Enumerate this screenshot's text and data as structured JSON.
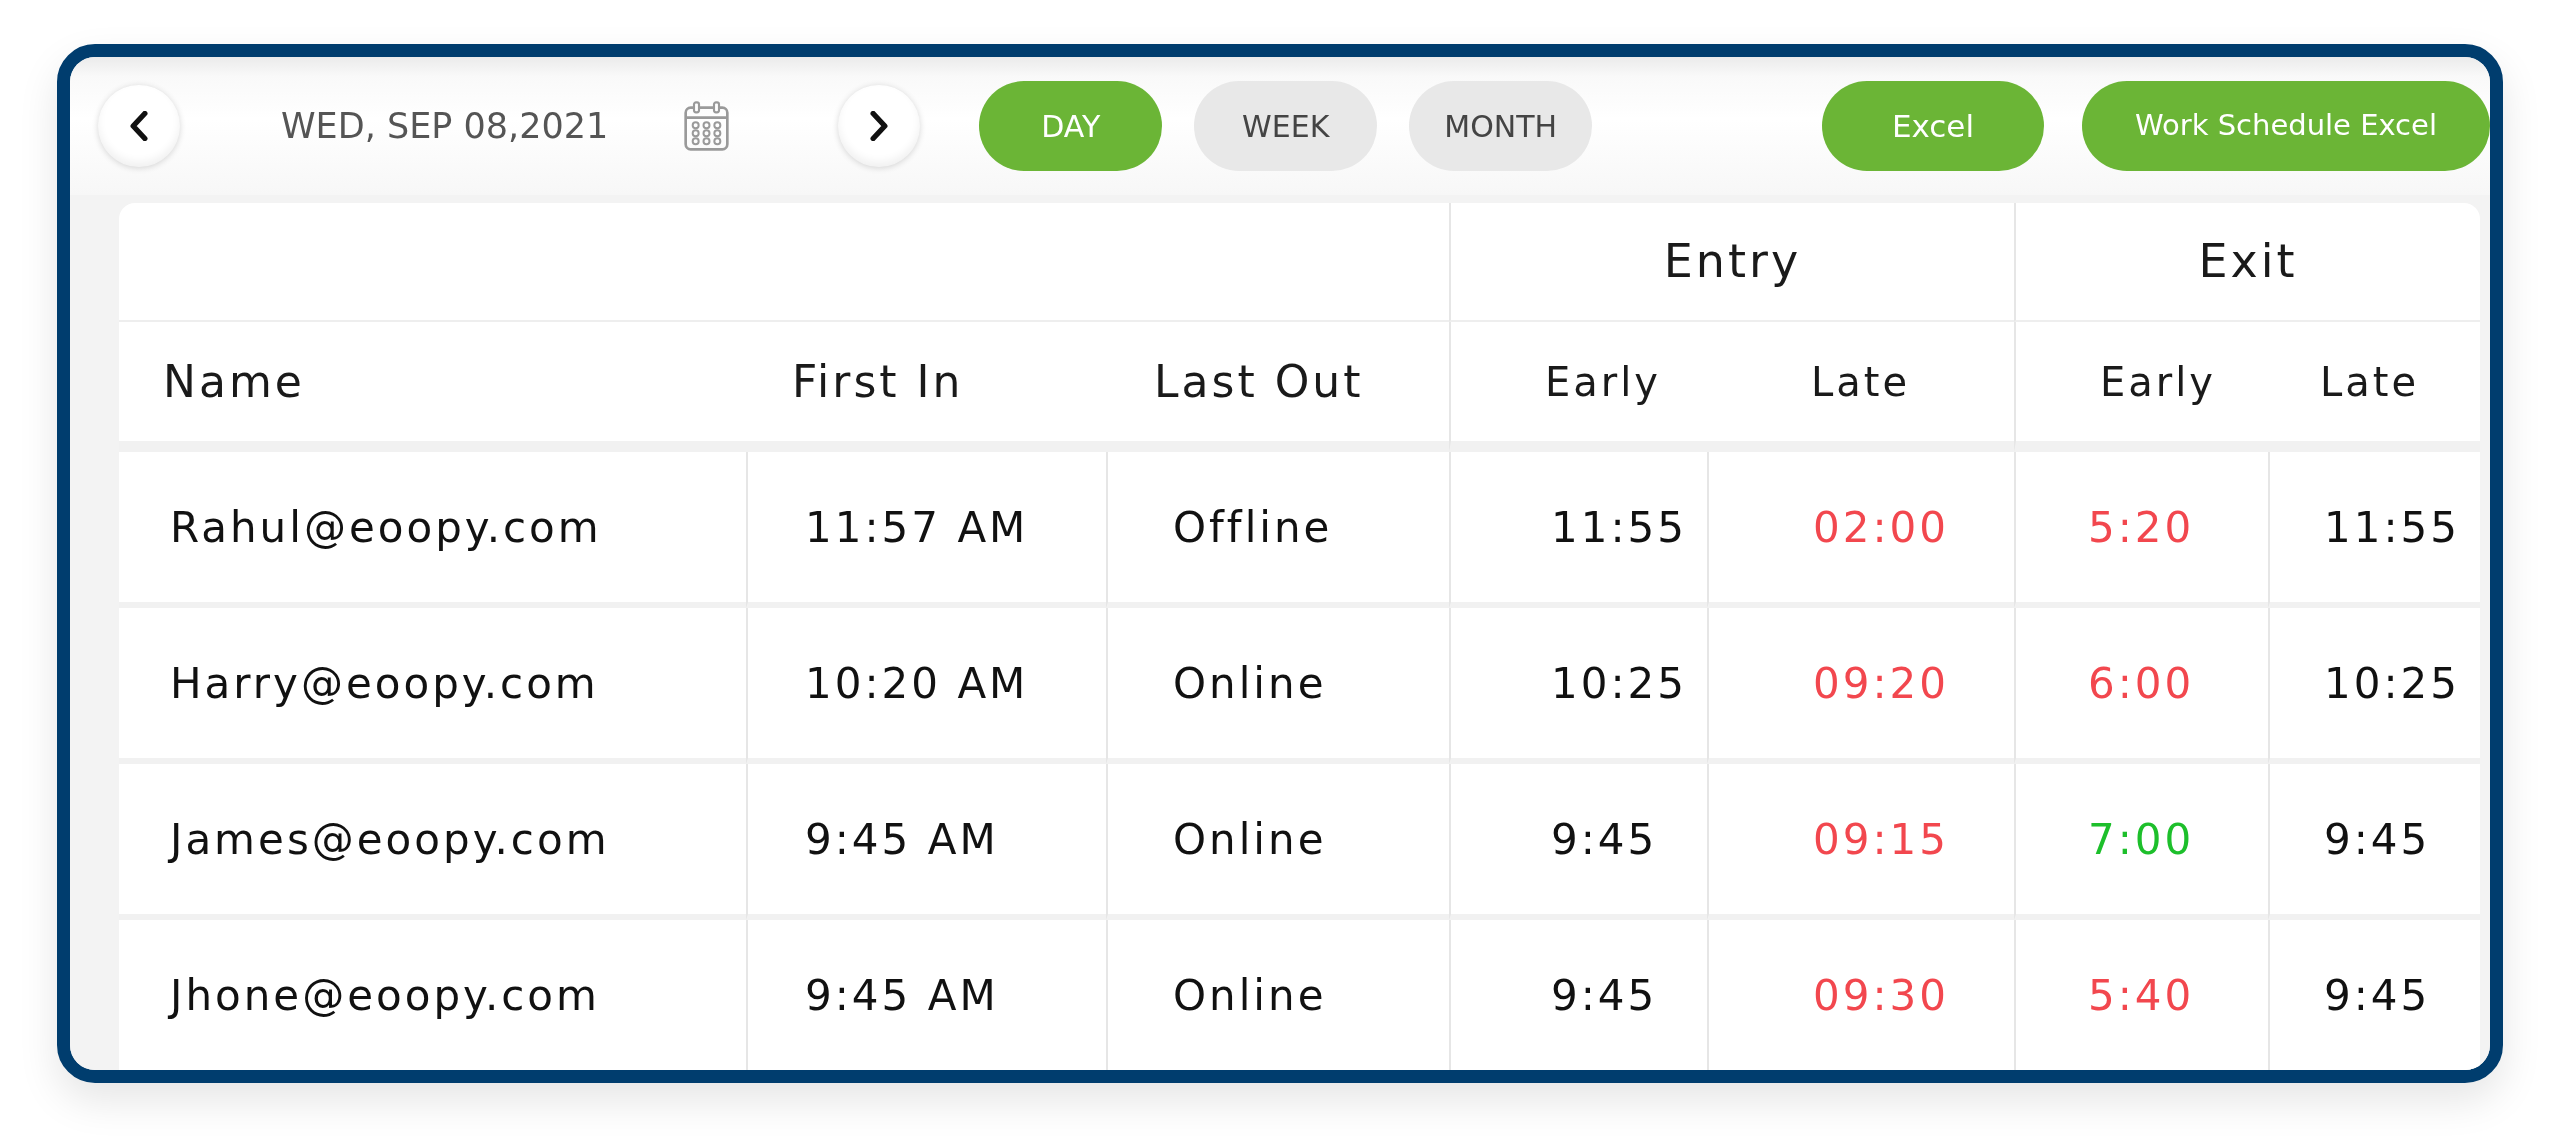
{
  "toolbar": {
    "date": "WED, SEP 08,2021",
    "views": [
      {
        "label": "DAY",
        "selected": true
      },
      {
        "label": "WEEK",
        "selected": false
      },
      {
        "label": "MONTH",
        "selected": false
      }
    ],
    "exports": [
      "Excel",
      "Work Schedule Excel"
    ]
  },
  "table": {
    "columns": [
      "Name",
      "First In",
      "Last Out"
    ],
    "groups": [
      {
        "label": "Entry",
        "columns": [
          "Early",
          "Late"
        ]
      },
      {
        "label": "Exit",
        "columns": [
          "Early",
          "Late"
        ]
      }
    ],
    "rows": [
      {
        "name": "Rahul@eoopy.com",
        "first_in": "11:57 AM",
        "last_out": "Offline",
        "entry": [
          {
            "value": "11:55"
          },
          {
            "value": "02:00",
            "color": "#f2474e"
          }
        ],
        "exit": [
          {
            "value": "5:20",
            "color": "#f2474e"
          },
          {
            "value": "11:55"
          }
        ]
      },
      {
        "name": "Harry@eoopy.com",
        "first_in": "10:20 AM",
        "last_out": "Online",
        "entry": [
          {
            "value": "10:25"
          },
          {
            "value": "09:20",
            "color": "#f2474e"
          }
        ],
        "exit": [
          {
            "value": "6:00",
            "color": "#f2474e"
          },
          {
            "value": "10:25"
          }
        ]
      },
      {
        "name": "James@eoopy.com",
        "first_in": "9:45 AM",
        "last_out": "Online",
        "entry": [
          {
            "value": "9:45"
          },
          {
            "value": "09:15",
            "color": "#f2474e"
          }
        ],
        "exit": [
          {
            "value": "7:00",
            "color": "#1dbf2b"
          },
          {
            "value": "9:45"
          }
        ]
      },
      {
        "name": "Jhone@eoopy.com",
        "first_in": "9:45 AM",
        "last_out": "Online",
        "entry": [
          {
            "value": "9:45"
          },
          {
            "value": "09:30",
            "color": "#f2474e"
          }
        ],
        "exit": [
          {
            "value": "5:40",
            "color": "#f2474e"
          },
          {
            "value": "9:45"
          }
        ]
      }
    ]
  }
}
